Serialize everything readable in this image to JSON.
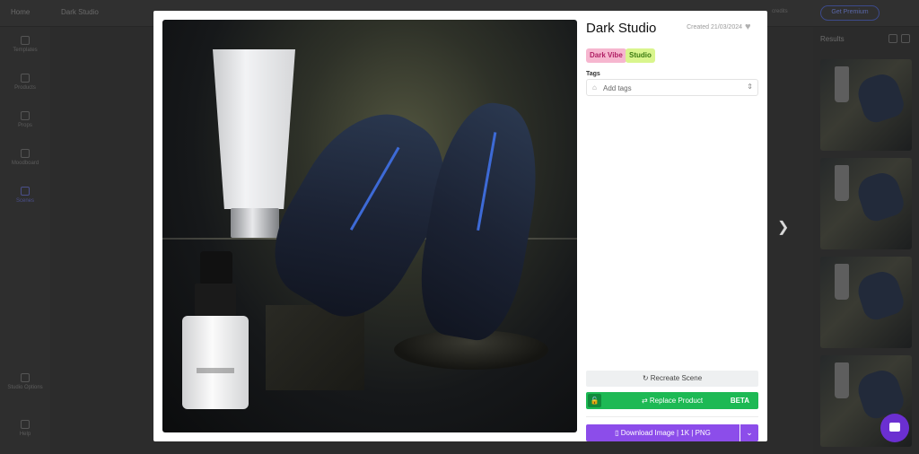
{
  "background_app": {
    "topbar": {
      "home_label": "Home",
      "project_title": "Dark Studio",
      "credits_text": "credits",
      "premium_label": "Get Premium"
    },
    "sidebar": {
      "items": [
        {
          "label": "Templates"
        },
        {
          "label": "Products"
        },
        {
          "label": "Props"
        },
        {
          "label": "Moodboard"
        },
        {
          "label": "Scenes"
        },
        {
          "label": "Studio Options"
        },
        {
          "label": "Help"
        }
      ]
    },
    "results_panel": {
      "header": "Results"
    }
  },
  "modal": {
    "title": "Dark Studio",
    "created": "Created 21/03/2024",
    "chips": [
      {
        "label": "Dark Vibe"
      },
      {
        "label": "Studio"
      }
    ],
    "tags": {
      "label": "Tags",
      "placeholder": "Add tags"
    },
    "actions": {
      "recreate_label": "Recreate Scene",
      "replace_label": "Replace Product",
      "replace_badge": "BETA",
      "download_label": "Download Image | 1K | PNG"
    }
  },
  "colors": {
    "chip_pink": "#f6b6cf",
    "chip_green": "#d9f58d",
    "replace_green": "#1db954",
    "download_purple": "#8c4dea",
    "chat_purple": "#6b2fd1"
  },
  "icons": {
    "heart": "heart-icon",
    "tag": "tag-icon",
    "chevron_updown": "chevron-updown-icon",
    "recreate": "recreate-icon",
    "lock": "lock-icon",
    "replace": "swap-icon",
    "download_file": "file-icon",
    "download_chevron": "chevron-down-icon",
    "next": "chevron-right-icon",
    "chat": "chat-icon"
  }
}
